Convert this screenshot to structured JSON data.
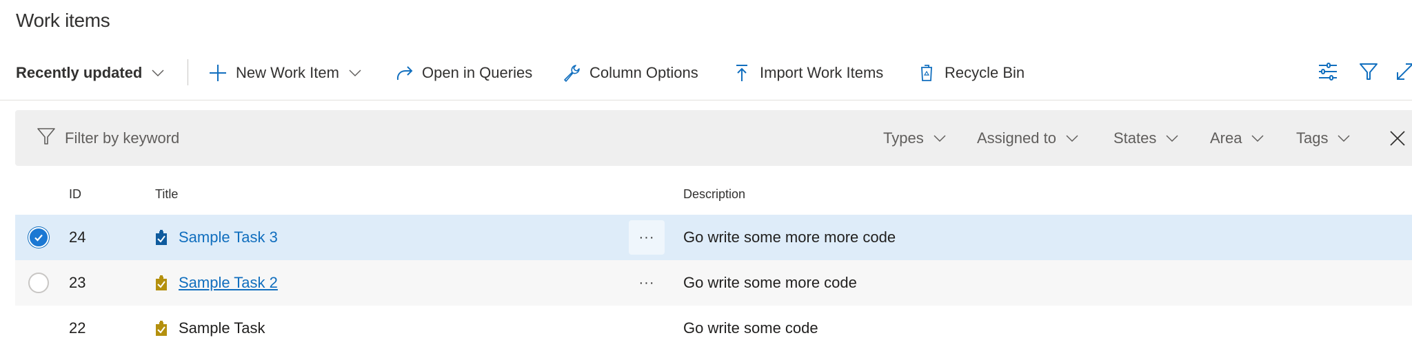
{
  "page": {
    "title": "Work items"
  },
  "toolbar": {
    "view_selector": "Recently updated",
    "new_work_item": "New Work Item",
    "open_in_queries": "Open in Queries",
    "column_options": "Column Options",
    "import_work_items": "Import Work Items",
    "recycle_bin": "Recycle Bin",
    "right_icons": [
      "view-options-icon",
      "filter-icon",
      "expand-icon"
    ]
  },
  "filter_bar": {
    "keyword_placeholder": "Filter by keyword",
    "dropdowns": [
      "Types",
      "Assigned to",
      "States",
      "Area",
      "Tags"
    ]
  },
  "grid": {
    "columns": [
      "ID",
      "Title",
      "Description"
    ],
    "rows": [
      {
        "id": "24",
        "title": "Sample Task 3",
        "description": "Go write some more more code",
        "selected": true,
        "icon_color": "#0f5b9e"
      },
      {
        "id": "23",
        "title": "Sample Task 2",
        "description": "Go write some more code",
        "selected": false,
        "icon_color": "#b4900e"
      },
      {
        "id": "22",
        "title": "Sample Task",
        "description": "Go write some code",
        "selected": false,
        "icon_color": "#b4900e"
      }
    ],
    "more_label": "···"
  },
  "colors": {
    "accent": "#106ebe",
    "selected_row": "#deecf9",
    "hover_row": "#f7f7f7",
    "filter_bar_bg": "#efefef",
    "task_icon_gold": "#b4900e",
    "task_icon_blue": "#0f5b9e"
  }
}
